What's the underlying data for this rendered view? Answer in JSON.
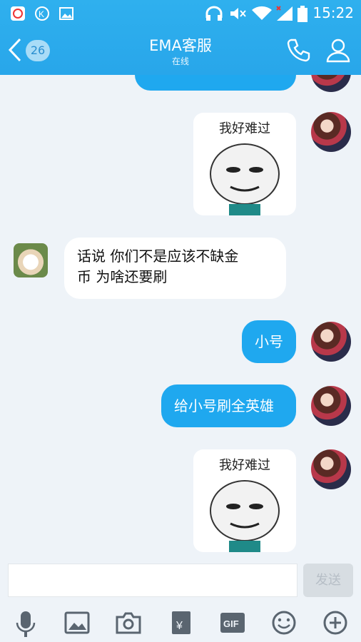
{
  "status_bar": {
    "time": "15:22"
  },
  "header": {
    "back_count": "26",
    "title": "EMA客服",
    "subtitle": "在线"
  },
  "messages": [
    {
      "from": "self",
      "type": "text",
      "text": ""
    },
    {
      "from": "self",
      "type": "sticker",
      "caption": "我好难过"
    },
    {
      "from": "other",
      "type": "text",
      "text_line1": "话说  你们不是应该不缺金",
      "text_line2": "币 为啥还要刷"
    },
    {
      "from": "self",
      "type": "text",
      "text": "小号"
    },
    {
      "from": "self",
      "type": "text",
      "text": "给小号刷全英雄"
    },
    {
      "from": "self",
      "type": "sticker",
      "caption": "我好难过"
    }
  ],
  "input": {
    "placeholder": "",
    "send_label": "发送"
  },
  "toolbar": {
    "gif_label": "GIF",
    "red_packet_label": "¥"
  },
  "colors": {
    "accent": "#1fa8ef",
    "background": "#eef3f8"
  }
}
